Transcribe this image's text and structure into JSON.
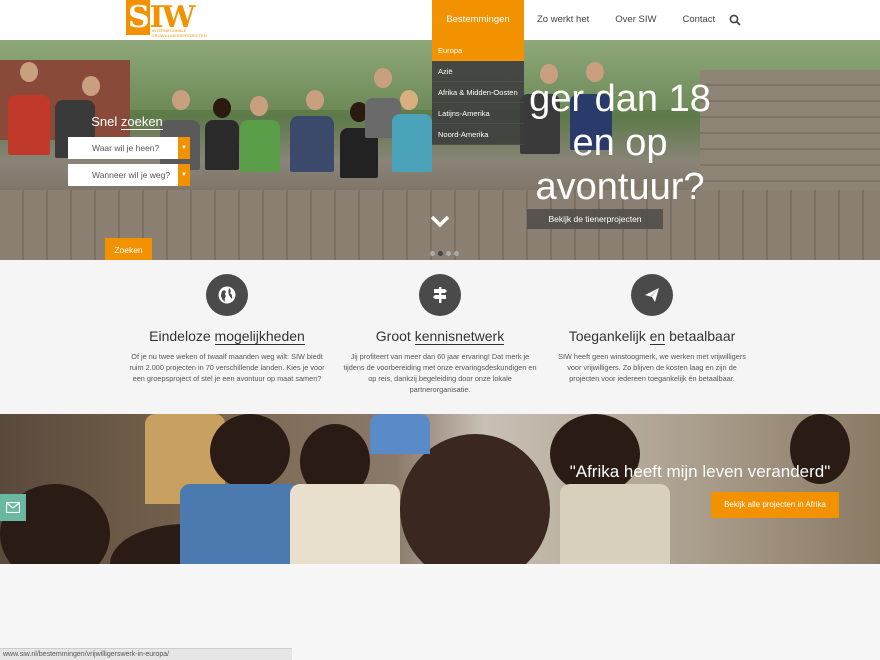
{
  "logo": {
    "mark": "SIW",
    "subtitle": "INTERNATIONALE VRIJWILLIGERSPROJECTEN"
  },
  "nav": {
    "items": [
      {
        "label": "Bestemmingen"
      },
      {
        "label": "Zo werkt het"
      },
      {
        "label": "Over SIW"
      },
      {
        "label": "Contact"
      }
    ],
    "search_icon": "search-icon"
  },
  "dropdown": {
    "items": [
      {
        "label": "Europa"
      },
      {
        "label": "Azië"
      },
      {
        "label": "Afrika & Midden-Oosten"
      },
      {
        "label": "Latijns-Amerika"
      },
      {
        "label": "Noord-Amerika"
      }
    ]
  },
  "quick_search": {
    "title_plain": "Snel ",
    "title_underlined": "zoeken",
    "where_placeholder": "Waar wil je heen?",
    "when_placeholder": "Wanneer wil je weg?",
    "button": "Zoeken"
  },
  "hero": {
    "headline_line1": "ger dan 18",
    "headline_line2": "en op",
    "headline_line3": "avontuur?",
    "cta": "Bekijk de tienerprojecten",
    "slides_count": 4,
    "active_slide": 2
  },
  "features": [
    {
      "icon": "globe-icon",
      "title_plain": "Eindeloze ",
      "title_underlined": "mogelijkheden",
      "text": "Of je nu twee weken of twaalf maanden weg wilt: SIW biedt ruim 2.000 projecten in 70 verschillende landen. Kies je voor een groepsproject of stel je een avontuur op maat samen?"
    },
    {
      "icon": "signpost-icon",
      "title_plain": "Groot ",
      "title_underlined": "kennisnetwerk",
      "text": "Jij profiteert van meer dan 60 jaar ervaring! Dat merk je tijdens de voorbereiding met onze ervaringsdeskundigen en op reis, dankzij begeleiding door onze lokale partnerorganisatie."
    },
    {
      "icon": "paper-plane-icon",
      "title_plain": "Toegankelijk ",
      "title_underlined": "en",
      "title_after": " betaalbaar",
      "text": "SIW heeft geen winstoogmerk, we werken met vrijwilligers voor vrijwilligers. Zo blijven de kosten laag en zijn de projecten voor iedereen toegankelijk én betaalbaar."
    }
  ],
  "africa": {
    "quote": "\"Afrika heeft mijn leven veranderd\"",
    "cta": "Bekijk alle projecten in Afrika"
  },
  "status_bar": {
    "url": "www.siw.nl/bestemmingen/vrijwilligerswerk-in-europa/"
  },
  "colors": {
    "accent": "#f39200",
    "dark": "#4a4a4a",
    "mail_tab": "#6bb8a0"
  }
}
